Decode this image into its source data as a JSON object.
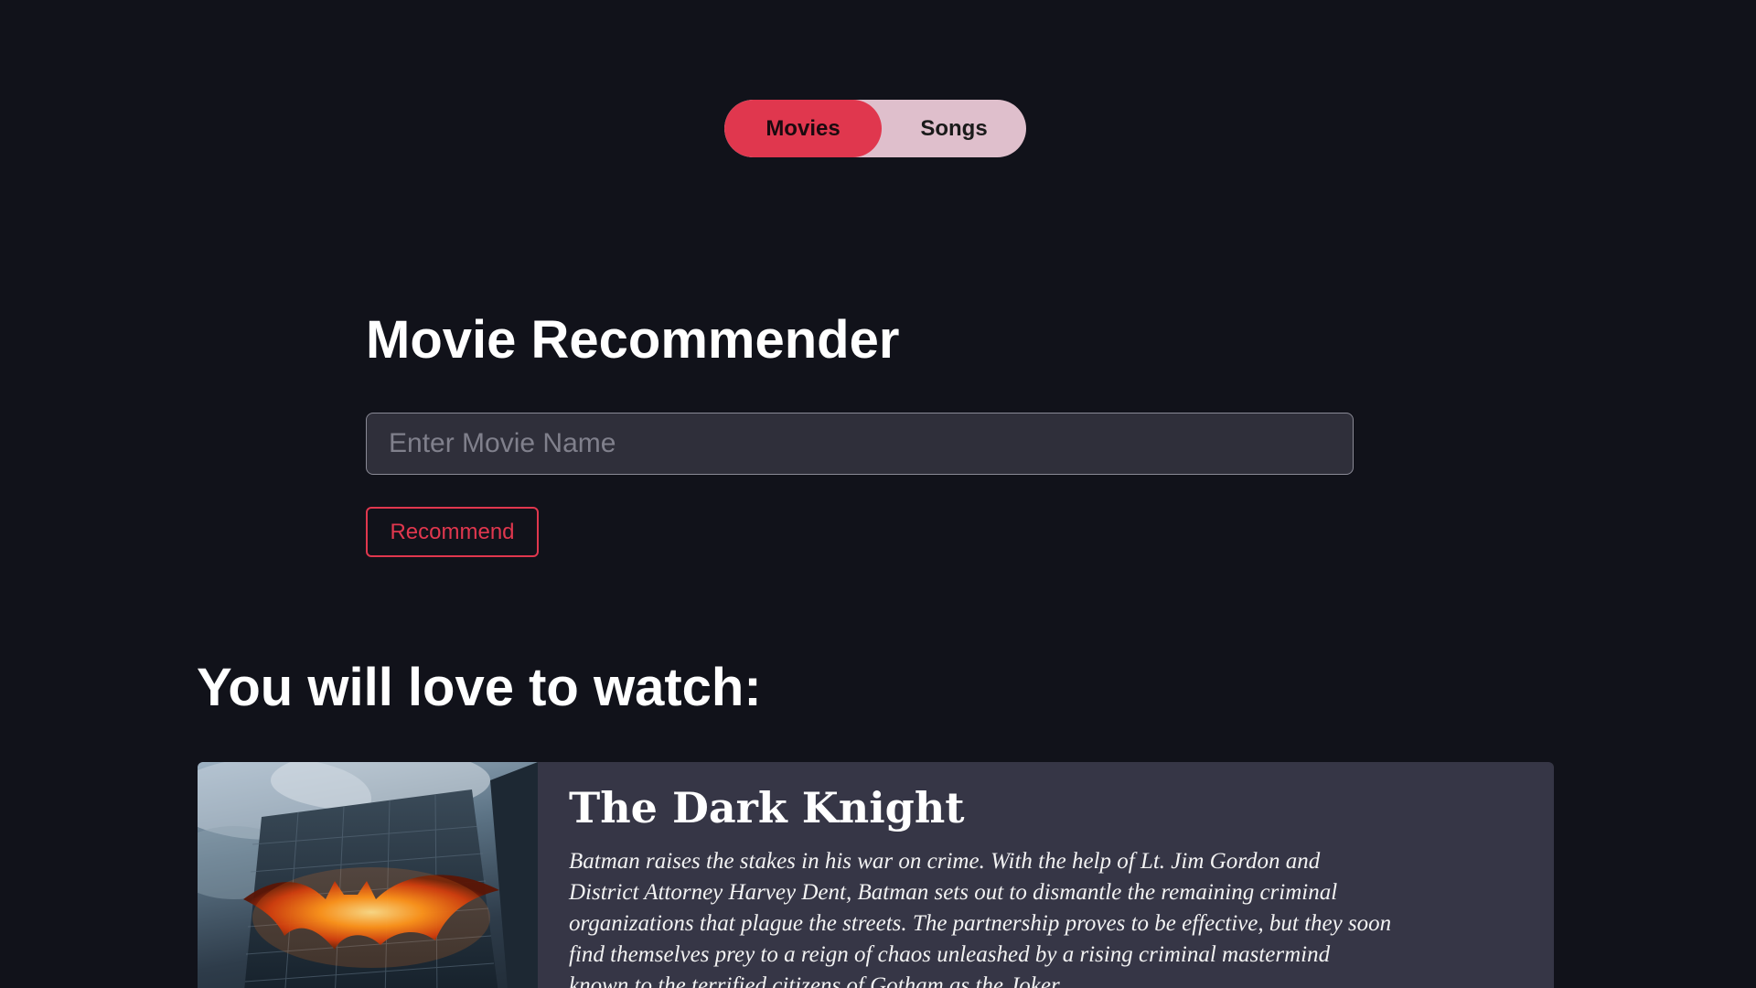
{
  "toggle": {
    "movies_label": "Movies",
    "songs_label": "Songs",
    "active": "Movies"
  },
  "main": {
    "title": "Movie Recommender",
    "search_placeholder": "Enter Movie Name",
    "search_value": "",
    "recommend_label": "Recommend"
  },
  "results": {
    "heading": "You will love to watch:",
    "items": [
      {
        "title": "The Dark Knight",
        "overview": "Batman raises the stakes in his war on crime. With the help of Lt. Jim Gordon and District Attorney Harvey Dent, Batman sets out to dismantle the remaining criminal organizations that plague the streets. The partnership proves to be effective, but they soon find themselves prey to a reign of chaos unleashed by a rising criminal mastermind known to the terrified citizens of Gotham as the Joker."
      }
    ]
  },
  "colors": {
    "background": "#11121a",
    "accent": "#e0374e",
    "toggle_inactive": "#dfbfcc",
    "card": "#363646",
    "input": "#2f2f3a"
  }
}
